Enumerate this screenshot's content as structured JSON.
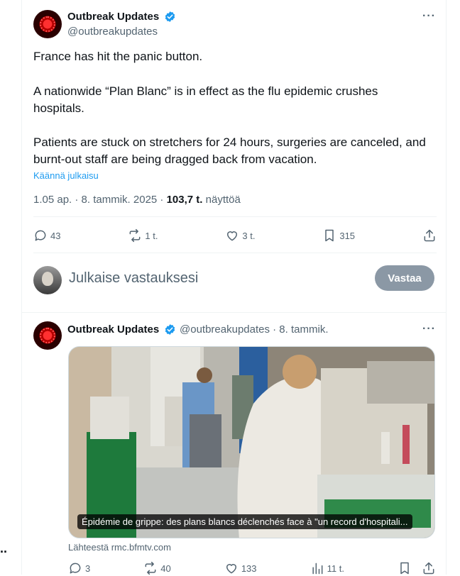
{
  "main_tweet": {
    "display_name": "Outbreak Updates",
    "handle": "@outbreakupdates",
    "more_label": "···",
    "line1": "France has hit the panic button.",
    "line2": "A nationwide “Plan Blanc” is in effect as the flu epidemic crushes hospitals.",
    "line3": "Patients are stuck on stretchers for 24 hours, surgeries are canceled, and burnt-out staff are being dragged back from vacation.",
    "translate": "Käännä julkaisu",
    "time_date": "1.05 ap. · 8. tammik. 2025 · ",
    "views_count": "103,7 t.",
    "views_label": " näyttöä",
    "actions": {
      "replies": "43",
      "reposts": "1 t.",
      "likes": "3 t.",
      "bookmarks": "315"
    }
  },
  "reply_box": {
    "placeholder": "Julkaise vastauksesi",
    "button": "Vastaa"
  },
  "second_tweet": {
    "display_name": "Outbreak Updates",
    "handle_date": "@outbreakupdates · 8. tammik.",
    "more_label": "···",
    "card_caption": "Épidémie de grippe: des plans blancs déclenchés face à \"un record d'hospitali...",
    "source": "Lähteestä rmc.bfmtv.com",
    "actions": {
      "replies": "3",
      "reposts": "40",
      "likes": "133",
      "views": "11 t."
    }
  },
  "edge_dots": "..",
  "colors": {
    "accent": "#1d9bf0",
    "text": "#0f1419",
    "muted": "#536471",
    "button_disabled": "#8b98a5"
  }
}
